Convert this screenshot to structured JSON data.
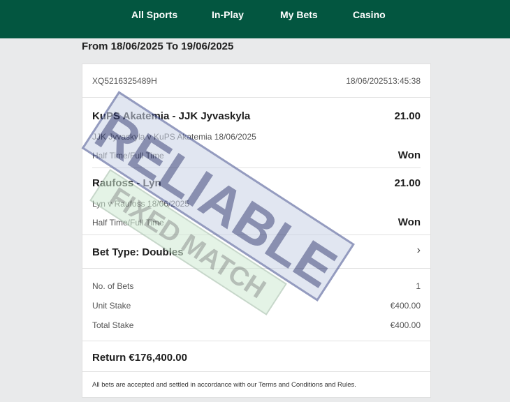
{
  "nav": {
    "items": [
      {
        "label": "All Sports"
      },
      {
        "label": "In-Play"
      },
      {
        "label": "My Bets"
      },
      {
        "label": "Casino"
      }
    ]
  },
  "date_range": "From 18/06/2025 To 19/06/2025",
  "bet": {
    "ref": "XQ5216325489H",
    "date": "18/06/2025",
    "time": "13:45:38",
    "selections": [
      {
        "title": "KuPS Akatemia - JJK Jyvaskyla",
        "odds": "21.00",
        "event": "JJK Jyvaskyla v KuPS Akatemia 18/06/2025",
        "market": "Half Time/Full Time",
        "result": "Won"
      },
      {
        "title": "Raufoss - Lyn",
        "odds": "21.00",
        "event": "Lyn v Raufoss 18/06/2025",
        "market": "Half Time/Full Time",
        "result": "Won"
      }
    ],
    "bet_type": "Bet Type: Doubles",
    "summary": {
      "no_of_bets_label": "No. of Bets",
      "no_of_bets": "1",
      "unit_stake_label": "Unit Stake",
      "unit_stake": "€400.00",
      "total_stake_label": "Total Stake",
      "total_stake": "€400.00"
    },
    "return_text": "Return €176,400.00",
    "footer_note": "All bets are accepted and settled in accordance with our Terms and Conditions and Rules."
  },
  "watermark": {
    "line1": "RELIABLE",
    "line2": "FIXED MATCH"
  }
}
